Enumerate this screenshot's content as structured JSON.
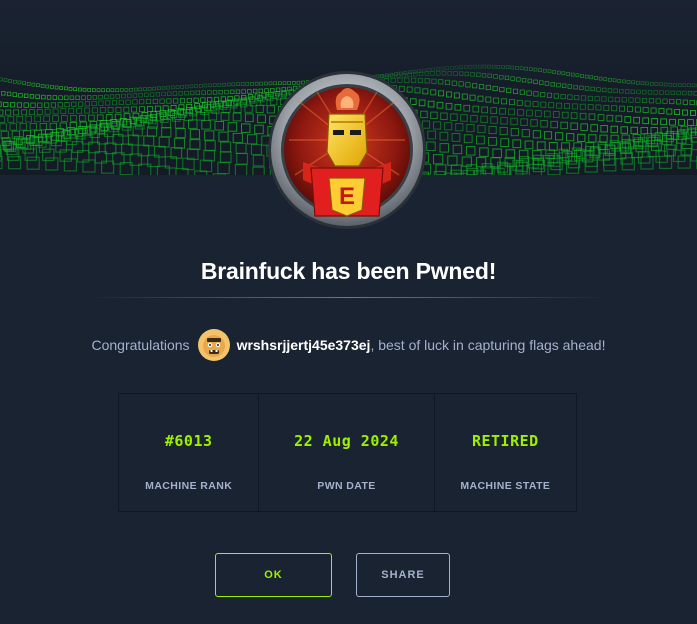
{
  "header": {
    "badge_icon": "machine-badge-icon"
  },
  "main": {
    "title": "Brainfuck has been Pwned!",
    "congrats_prefix": "Congratulations",
    "username": "wrshsrjjertj45e373ej",
    "congrats_suffix": ", best of luck in capturing flags ahead!",
    "avatar_icon": "user-avatar-icon"
  },
  "stats": [
    {
      "value": "#6013",
      "label": "MACHINE RANK"
    },
    {
      "value": "22 Aug 2024",
      "label": "PWN DATE"
    },
    {
      "value": "RETIRED",
      "label": "MACHINE STATE"
    }
  ],
  "actions": {
    "ok_label": "OK",
    "share_label": "SHARE"
  },
  "colors": {
    "background": "#1a2332",
    "accent": "#9fef00",
    "muted_text": "#a4b1cd",
    "heading_text": "#ffffff"
  }
}
